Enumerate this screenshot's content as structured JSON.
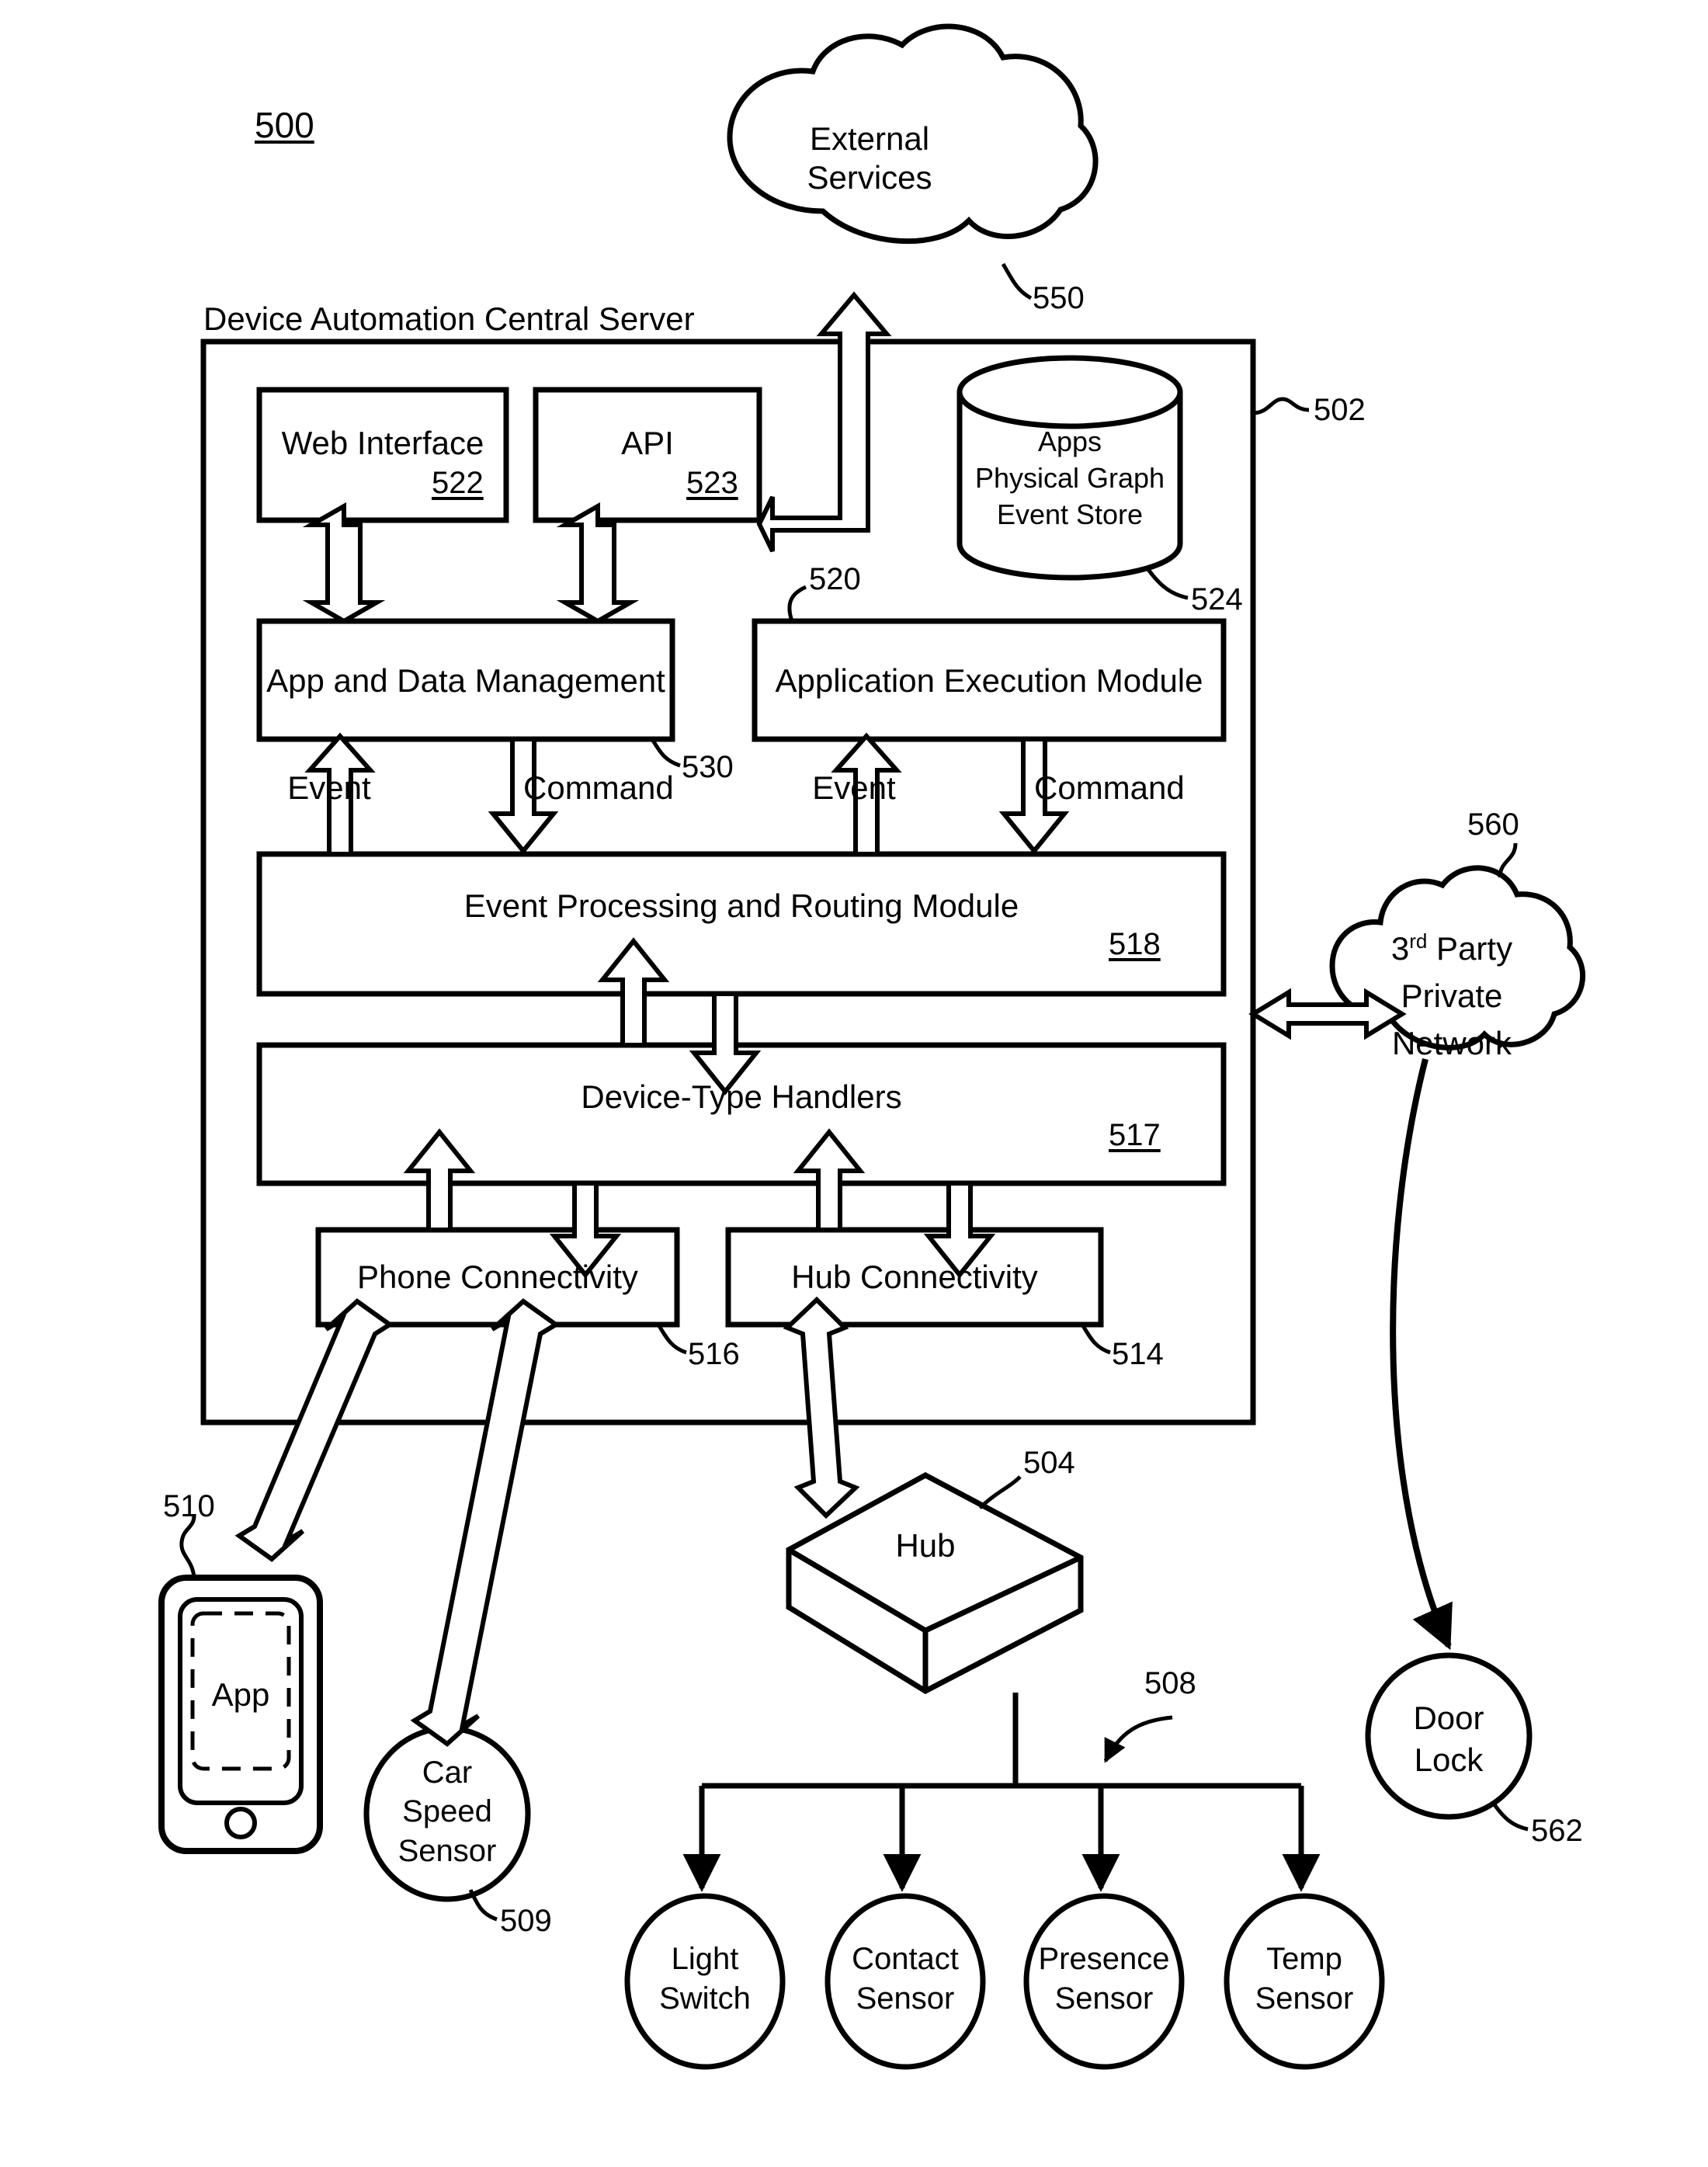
{
  "figure": {
    "figure_number": "500",
    "title": "Device Automation Central Server"
  },
  "nodes": {
    "external_services": {
      "label": "External\nServices",
      "ref": "550"
    },
    "server": {
      "label": "Device Automation Central Server",
      "ref": "502"
    },
    "web_interface": {
      "label": "Web Interface",
      "ref": "522"
    },
    "api": {
      "label": "API",
      "ref": "523"
    },
    "data_store": {
      "label": "Apps\nPhysical Graph\nEvent Store",
      "ref": "524"
    },
    "app_data_management": {
      "label": "App and Data Management",
      "ref": "530"
    },
    "application_execution_module": {
      "label": "Application Execution Module",
      "ref": "520"
    },
    "event_processing": {
      "label": "Event Processing and Routing Module",
      "ref": "518"
    },
    "device_type_handlers": {
      "label": "Device-Type Handlers",
      "ref": "517"
    },
    "phone_connectivity": {
      "label": "Phone Connectivity",
      "ref": "516"
    },
    "hub_connectivity": {
      "label": "Hub Connectivity",
      "ref": "514"
    },
    "third_party_network": {
      "label_line1": "3",
      "label_sup": "rd",
      "label_line1_rest": " Party",
      "label_line2": "Private",
      "label_line3": "Network",
      "ref": "560"
    },
    "phone": {
      "label": "App",
      "ref": "510"
    },
    "car_speed_sensor": {
      "label": "Car\nSpeed\nSensor",
      "ref": "509"
    },
    "hub": {
      "label": "Hub",
      "ref": "504"
    },
    "sensor_bus": {
      "ref": "508"
    },
    "door_lock": {
      "label": "Door\nLock",
      "ref": "562"
    }
  },
  "sensors": [
    {
      "label": "Light\nSwitch"
    },
    {
      "label": "Contact\nSensor"
    },
    {
      "label": "Presence\nSensor"
    },
    {
      "label": "Temp\nSensor"
    }
  ],
  "flow_labels": {
    "event_left": "Event",
    "command_left": "Command",
    "event_right": "Event",
    "command_right": "Command"
  },
  "colors": {
    "stroke": "#000000",
    "fill": "#ffffff"
  }
}
